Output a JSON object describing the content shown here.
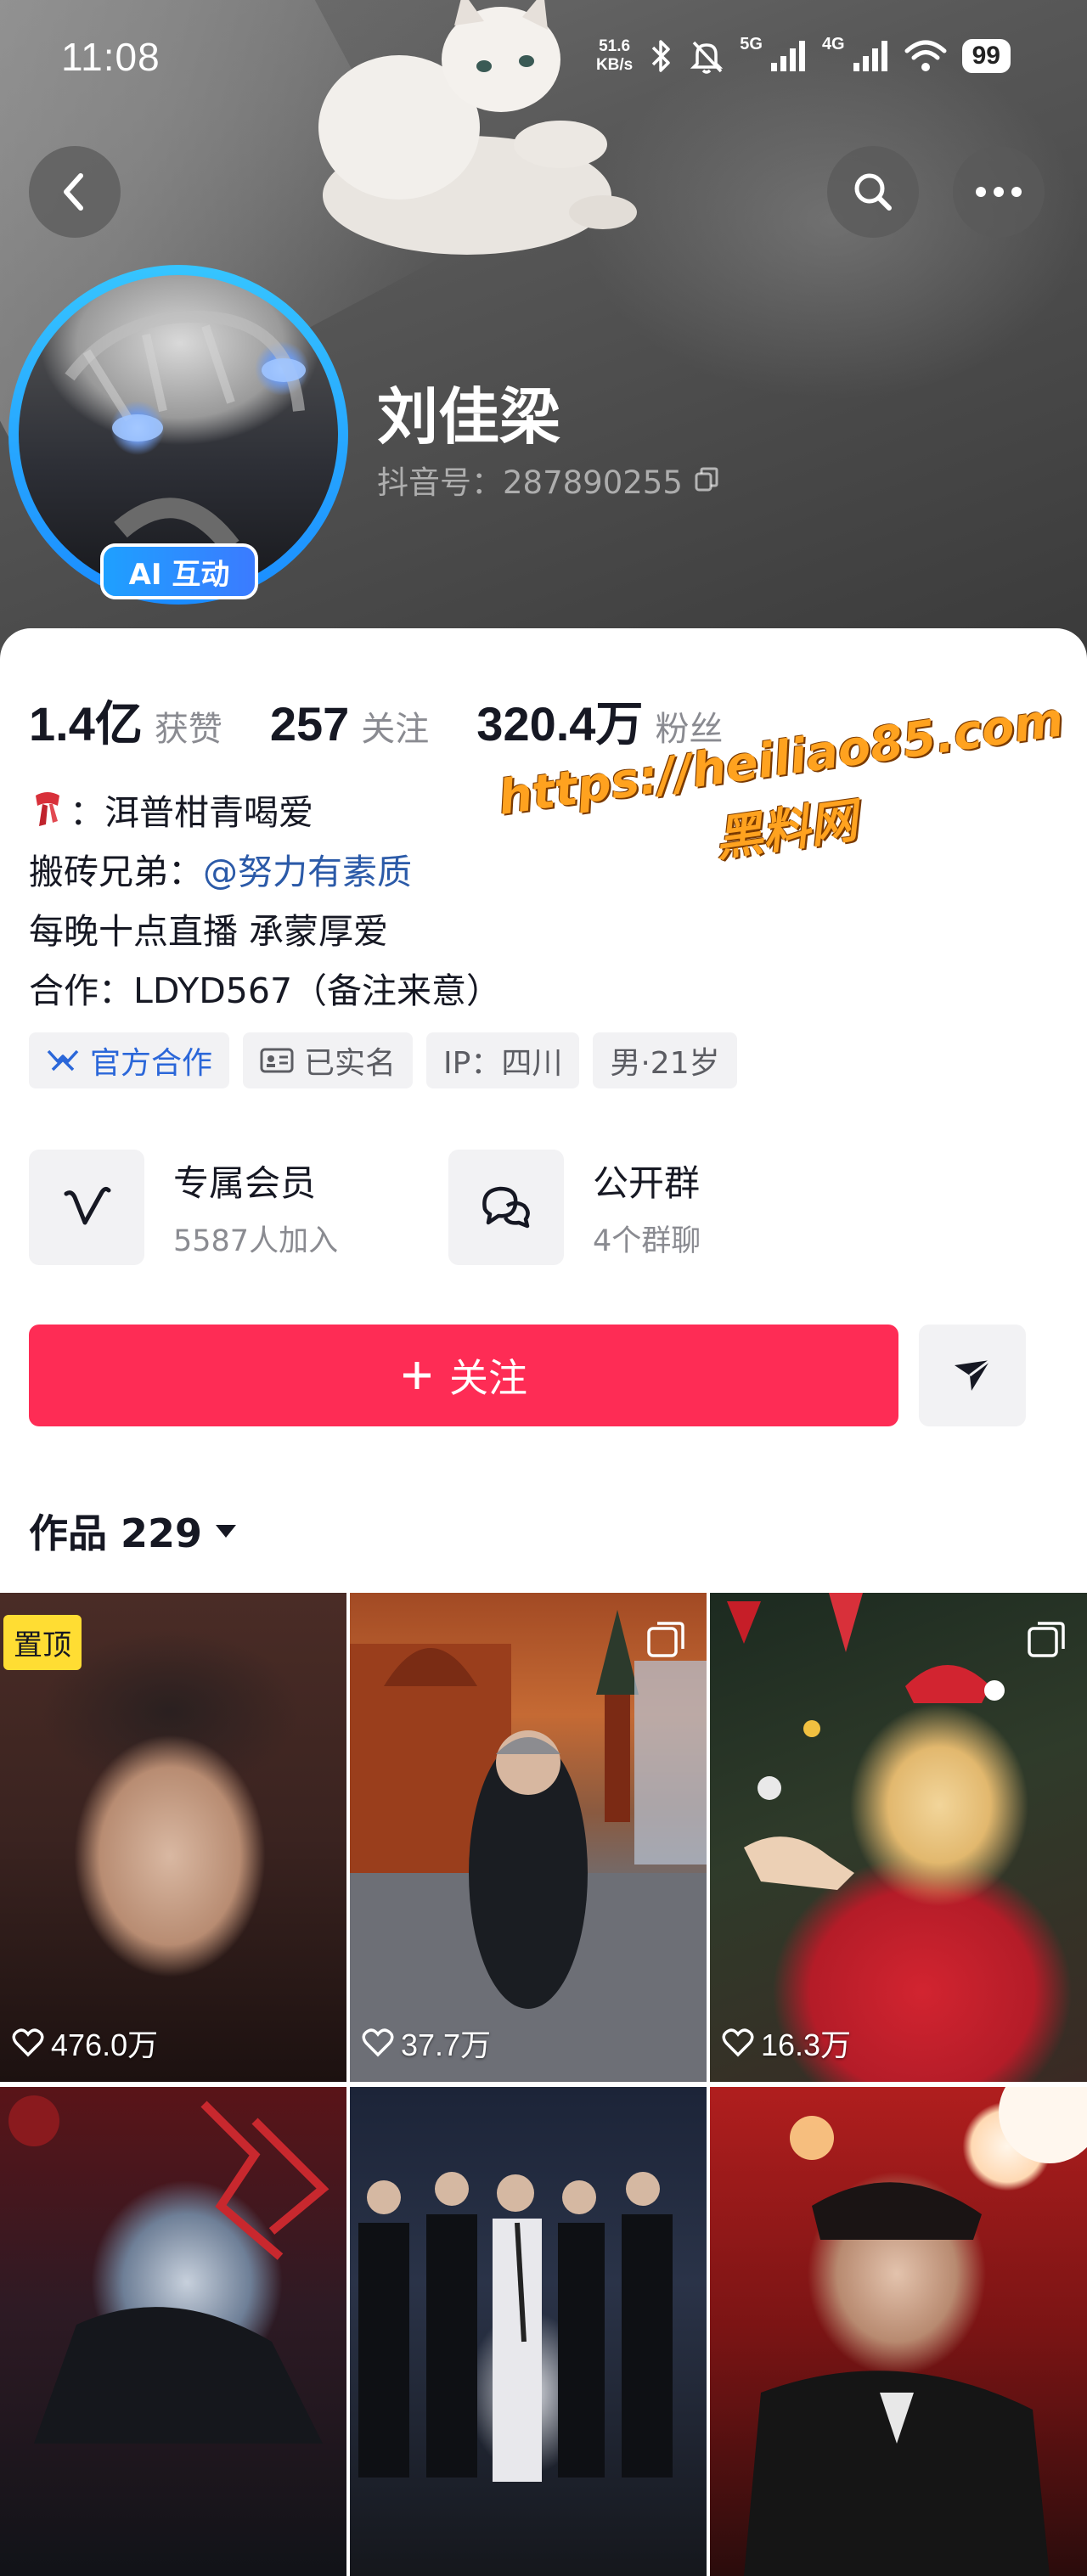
{
  "status_bar": {
    "time": "11:08",
    "net_speed_value": "51.6",
    "net_speed_unit": "KB/s",
    "signal_1_label": "5G",
    "signal_2_label": "4G",
    "battery": "99"
  },
  "profile": {
    "nickname": "刘佳梁",
    "douyin_id": "抖音号：287890255",
    "ai_badge": "AI 互动"
  },
  "stats": [
    {
      "value": "1.4亿",
      "label": "获赞"
    },
    {
      "value": "257",
      "label": "关注"
    },
    {
      "value": "320.4万",
      "label": "粉丝"
    }
  ],
  "bio": {
    "line1": "：洱普柑青喝爱",
    "line2_prefix": "搬砖兄弟：",
    "line2_mention": "@努力有素质",
    "line3": "每晚十点直播 承蒙厚爱",
    "line4": "合作：LDYD567（备注来意）"
  },
  "tags": {
    "official": "官方合作",
    "verified": "已实名",
    "ip": "IP：四川",
    "gender_age": "男·21岁"
  },
  "services": [
    {
      "title": "专属会员",
      "subtitle": "5587人加入"
    },
    {
      "title": "公开群",
      "subtitle": "4个群聊"
    }
  ],
  "actions": {
    "follow": "关注"
  },
  "works": {
    "header": "作品 229"
  },
  "watermark": {
    "url": "https://heiliao85.com",
    "name": "黑料网"
  },
  "videos": [
    {
      "likes": "476.0万",
      "pinned": "置顶"
    },
    {
      "likes": "37.7万"
    },
    {
      "likes": "16.3万"
    }
  ],
  "colors": {
    "follow_button": "#fe2c55",
    "mention": "#2b5aa8",
    "official_tag": "#2b67d9",
    "ai_badge": "#1ea0ff"
  }
}
